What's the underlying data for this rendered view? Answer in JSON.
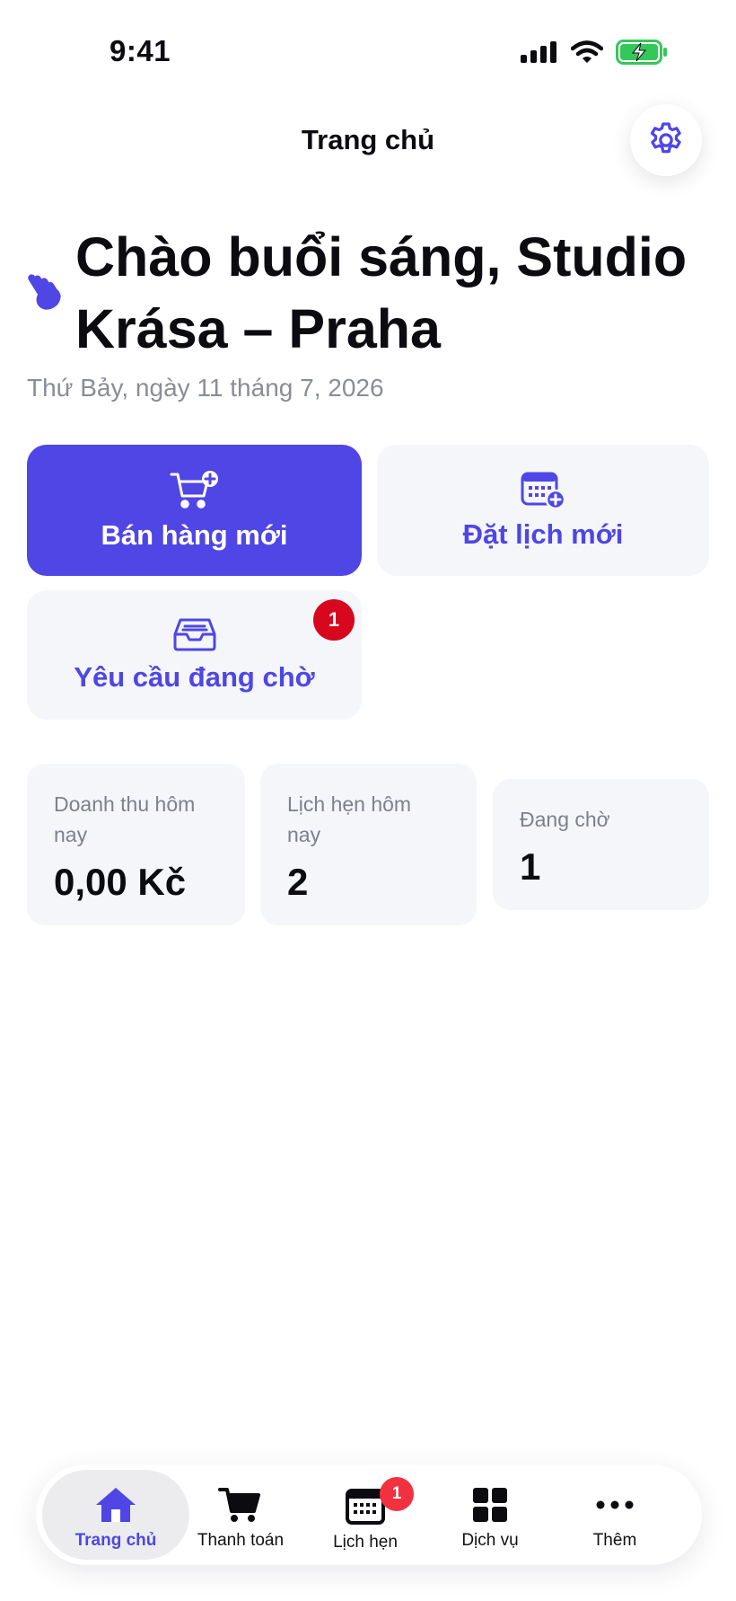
{
  "status_bar": {
    "time": "9:41"
  },
  "header": {
    "title": "Trang chủ"
  },
  "greeting": {
    "text": "Chào buổi sáng, Studio Krása – Praha",
    "date": "Thứ Bảy, ngày 11 tháng 7, 2026"
  },
  "actions": {
    "new_sale": "Bán hàng mới",
    "new_booking": "Đặt lịch mới",
    "pending_requests": "Yêu cầu đang chờ",
    "pending_badge": "1"
  },
  "stats": {
    "revenue": {
      "label": "Doanh thu hôm nay",
      "value": "0,00 Kč"
    },
    "appointments": {
      "label": "Lịch hẹn hôm nay",
      "value": "2"
    },
    "pending": {
      "label": "Đang chờ",
      "value": "1"
    }
  },
  "tabs": {
    "home": "Trang chủ",
    "checkout": "Thanh toán",
    "appointments": "Lịch hẹn",
    "appointments_badge": "1",
    "services": "Dịch vụ",
    "more": "Thêm"
  },
  "colors": {
    "accent": "#4f46e5",
    "badge_red": "#d7071e",
    "battery_green": "#34c759",
    "tile_bg": "#f4f6fa"
  }
}
